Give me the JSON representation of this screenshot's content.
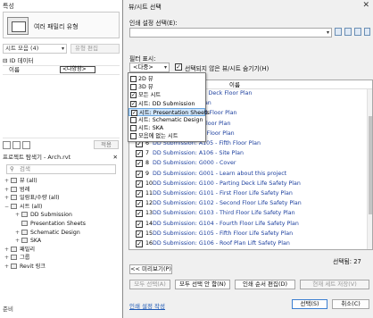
{
  "left": {
    "properties_title": "특성",
    "type_label": "여러 패밀리 유형",
    "sheet_count": "시트 모음 (4)",
    "edit_type": "유형 편집",
    "id_data": "ID 데이터",
    "name_key": "이름",
    "name_value": "<다양함>",
    "apply": "적용",
    "browser_title": "프로젝트 탐색기 - Arch.rvt",
    "search_placeholder": "검색",
    "tree": [
      {
        "toggle": "+",
        "label": "뷰 (all)",
        "level": 0
      },
      {
        "toggle": "+",
        "label": "범례",
        "level": 0
      },
      {
        "toggle": "+",
        "label": "일람표/수량 (all)",
        "level": 0
      },
      {
        "toggle": "−",
        "label": "시트 (all)",
        "level": 0
      },
      {
        "toggle": "+",
        "label": "DD Submission",
        "level": 1
      },
      {
        "toggle": "",
        "label": "Presentation Sheets",
        "level": 1
      },
      {
        "toggle": "+",
        "label": "Schematic Design",
        "level": 1
      },
      {
        "toggle": "+",
        "label": "SKA",
        "level": 1
      },
      {
        "toggle": "+",
        "label": "패밀리",
        "level": 0
      },
      {
        "toggle": "+",
        "label": "그룹",
        "level": 0
      },
      {
        "toggle": "+",
        "label": "Revit 링크",
        "level": 0
      }
    ],
    "status": "준비"
  },
  "dialog": {
    "title": "뷰/시트 선택",
    "print_setting_label": "인쇄 설정 선택(E):",
    "print_setting_value": "",
    "filter_label": "필터 표시:",
    "filter_value": "<다중>",
    "hide_unselected": "선택되지 않은 뷰/시트 숨기기(H)",
    "column_name": "이름",
    "filter_options": [
      {
        "label": "2D 뷰",
        "checked": false,
        "highlight": false
      },
      {
        "label": "3D 뷰",
        "checked": false,
        "highlight": false
      },
      {
        "label": "모든 시트",
        "checked": true,
        "highlight": false
      },
      {
        "label": "시트: DD Submission",
        "checked": true,
        "highlight": false
      },
      {
        "label": "시트: Presentation Sheets",
        "checked": true,
        "highlight": true
      },
      {
        "label": "시트: Schematic Design",
        "checked": false,
        "highlight": false
      },
      {
        "label": "시트: SKA",
        "checked": false,
        "highlight": false
      },
      {
        "label": "모음에 없는 시트",
        "checked": false,
        "highlight": false
      }
    ],
    "rows": [
      {
        "num": "1",
        "text": "시트: A100 - Parting Deck Floor Plan"
      },
      {
        "num": "2",
        "text": "시트: A101 - Site Plan"
      },
      {
        "num": "3",
        "text": "시트: A102 - Second Floor Plan"
      },
      {
        "num": "4",
        "text": "시트: A103 - Third Floor Plan"
      },
      {
        "num": "5",
        "text": "시트: A104 - Fourth Floor Plan"
      },
      {
        "num": "6",
        "text": "DD Submission: A105 - Fifth Floor Plan"
      },
      {
        "num": "7",
        "text": "DD Submission: A106 - Site Plan"
      },
      {
        "num": "8",
        "text": "DD Submission: G000 - Cover"
      },
      {
        "num": "9",
        "text": "DD Submission: G001 - Learn about this project"
      },
      {
        "num": "10",
        "text": "DD Submission: G100 - Parting Deck Life Safety Plan"
      },
      {
        "num": "11",
        "text": "DD Submission: G101 - First Floor Life Safety Plan"
      },
      {
        "num": "12",
        "text": "DD Submission: G102 - Second Floor Life Safety Plan"
      },
      {
        "num": "13",
        "text": "DD Submission: G103 - Third Floor Life Safety Plan"
      },
      {
        "num": "14",
        "text": "DD Submission: G104 - Fourth Floor Life Safety Plan"
      },
      {
        "num": "15",
        "text": "DD Submission: G105 - Fifth Floor Life Safety Plan"
      },
      {
        "num": "16",
        "text": "DD Submission: G106 - Roof Plan Lift Safety Plan"
      }
    ],
    "selected_count": "선택됨: 27",
    "less_button": "<< 미리보기(P)",
    "btn_select_all": "모두 선택(A)",
    "btn_clear_all": "모두 선택 안 함(N)",
    "btn_print_settings": "인쇄 순서 편집(D)",
    "btn_save_current": "현재 세트 저장(V)",
    "print_settings_link": "인쇄 설정 작성",
    "ok": "선택(S)",
    "cancel": "취소(C)"
  },
  "colors": {
    "link": "#1c3f9e",
    "highlight": "#cfe5fb",
    "primary_border": "#3c7fd1"
  }
}
